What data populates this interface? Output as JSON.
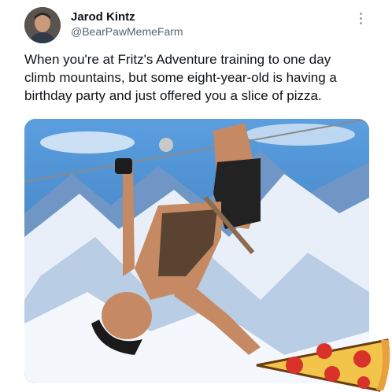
{
  "author": {
    "name": "Jarod Kintz",
    "handle": "@BearPawMemeFarm",
    "avatar_icon": "profile-photo"
  },
  "tweet": {
    "text": "When you're at Fritz's Adventure training to one day climb mountains, but some eight-year-old is having a birthday party and just offered you a slice of pizza."
  },
  "icons": {
    "more": "more-options-icon",
    "sticker": "pizza-slice-sticker"
  },
  "colors": {
    "sky": "#3f7fc2",
    "snow": "#eef4fb",
    "pizza_crust": "#e8a13c",
    "pizza_cheese": "#f3c44a",
    "pepperoni": "#d8322a",
    "text_primary": "#0f1419",
    "text_secondary": "#536471"
  }
}
